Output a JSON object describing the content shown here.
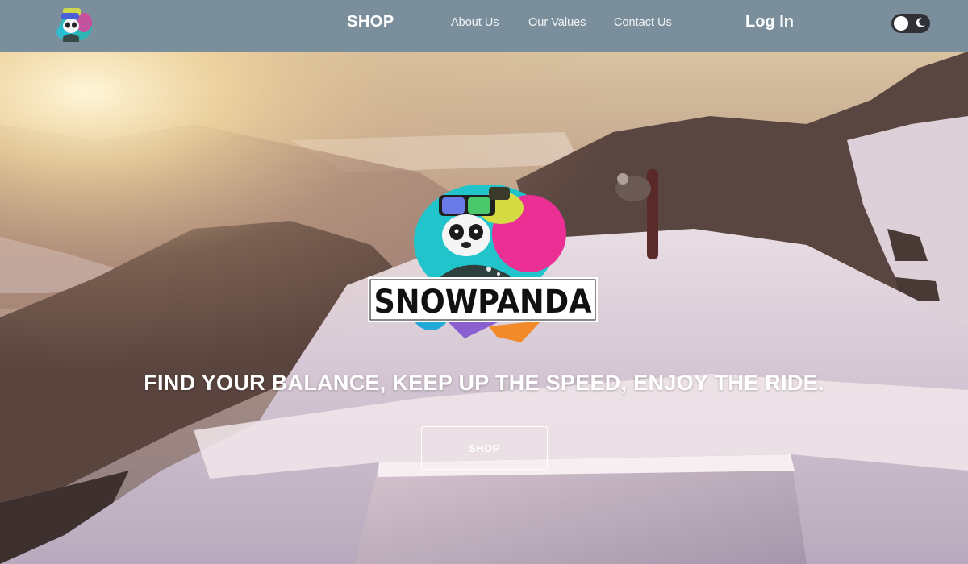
{
  "nav": {
    "logo_icon": "snowpanda-logo-icon",
    "shop": "SHOP",
    "about": "About Us",
    "values": "Our Values",
    "contact": "Contact Us",
    "login": "Log In",
    "theme_toggle_icon": "moon-icon"
  },
  "hero": {
    "brand": "SNOWPANDA",
    "tagline": "FIND YOUR BALANCE, KEEP UP THE SPEED, ENJOY THE RIDE.",
    "button": "SHOP",
    "background": "snowboard-jump-sunset-mountains"
  },
  "colors": {
    "navbar": "#7a8f9b",
    "toggle": "#2f3136",
    "text": "#ffffff"
  }
}
